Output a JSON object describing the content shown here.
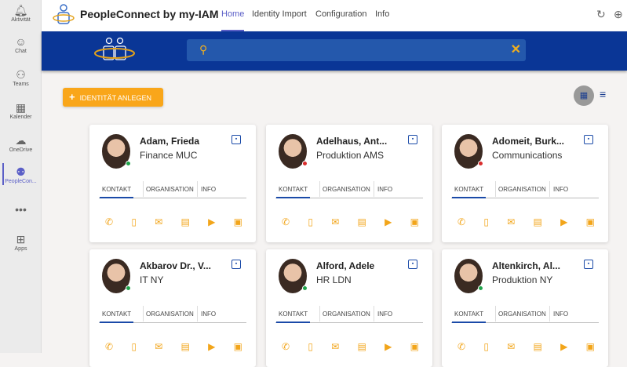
{
  "sidebar": {
    "items": [
      {
        "label": "Aktivität",
        "icon": "bell-icon"
      },
      {
        "label": "Chat",
        "icon": "chat-icon"
      },
      {
        "label": "Teams",
        "icon": "teams-icon"
      },
      {
        "label": "Kalender",
        "icon": "calendar-icon"
      },
      {
        "label": "OneDrive",
        "icon": "cloud-icon"
      },
      {
        "label": "PeopleCon...",
        "icon": "peopleconnect-icon"
      },
      {
        "label": "...",
        "icon": "more-icon"
      },
      {
        "label": "Apps",
        "icon": "apps-icon"
      }
    ]
  },
  "header": {
    "title": "PeopleConnect by my-IAM",
    "nav": [
      "Home",
      "Identity Import",
      "Configuration",
      "Info"
    ]
  },
  "search": {
    "placeholder": ""
  },
  "toolbar": {
    "add_label": "IDENTITÄT ANLEGEN"
  },
  "colors": {
    "accent": "#f9a61a",
    "brand": "#0a3696",
    "online": "#1fa34a",
    "busy": "#d92c2c"
  },
  "card_tabs": [
    "KONTAKT",
    "ORGANISATION",
    "INFO"
  ],
  "cards": [
    {
      "name": "Adam, Frieda",
      "dept": "Finance MUC",
      "status": "online"
    },
    {
      "name": "Adelhaus, Ant...",
      "dept": "Produktion AMS",
      "status": "busy"
    },
    {
      "name": "Adomeit, Burk...",
      "dept": "Communications",
      "status": "busy"
    },
    {
      "name": "Akbarov Dr., V...",
      "dept": "IT NY",
      "status": "online"
    },
    {
      "name": "Alford, Adele",
      "dept": "HR LDN",
      "status": "online"
    },
    {
      "name": "Altenkirch, Al...",
      "dept": "Produktion NY",
      "status": "online"
    }
  ]
}
